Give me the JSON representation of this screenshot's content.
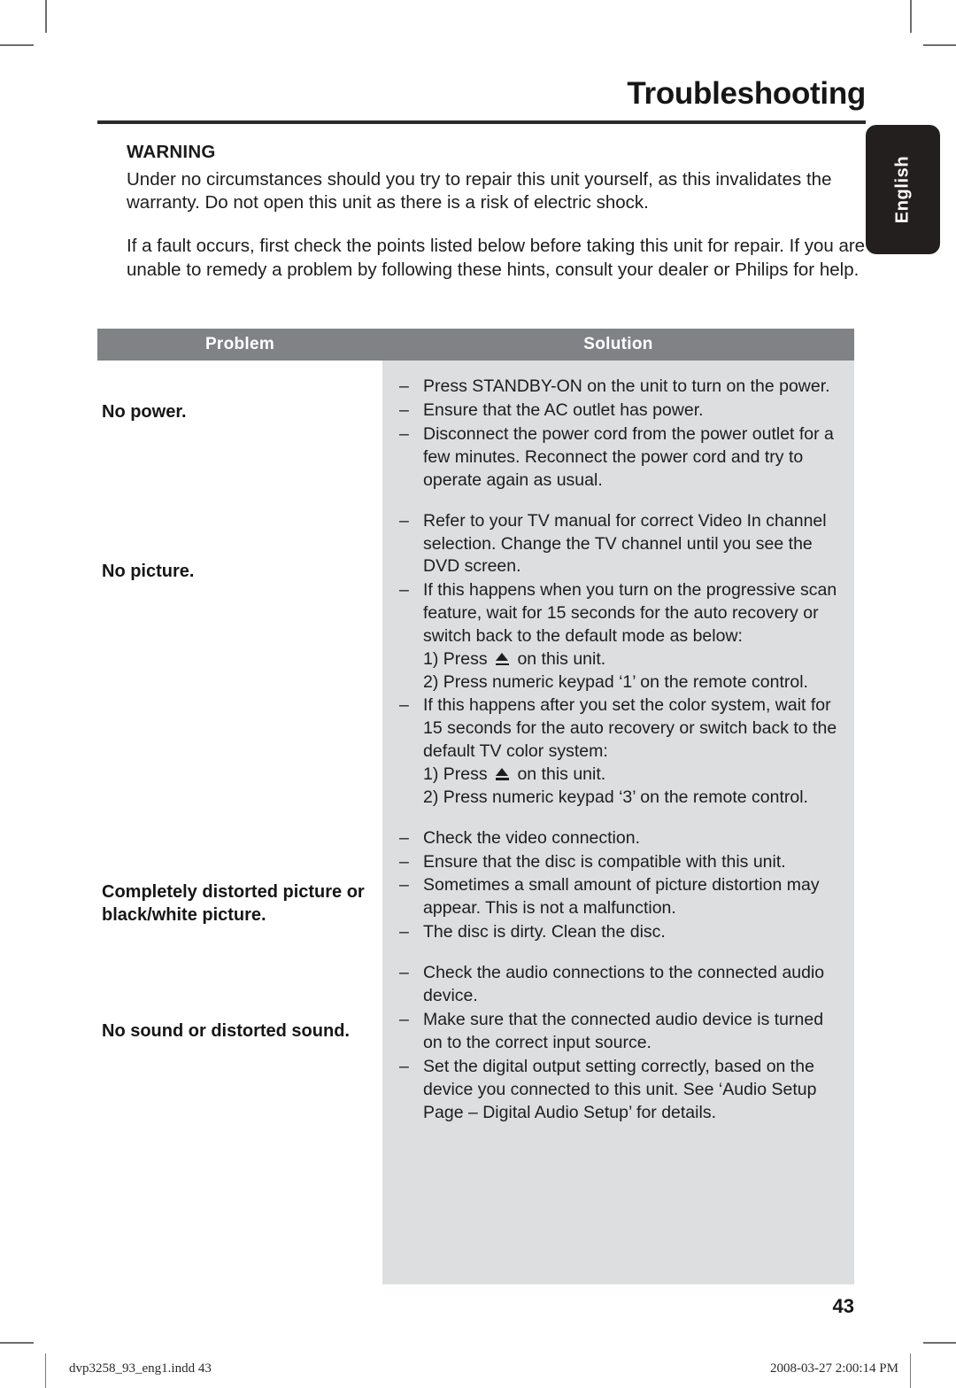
{
  "document": {
    "page_title": "Troubleshooting",
    "page_number": "43",
    "language_tab": "English"
  },
  "intro": {
    "warning_heading": "WARNING",
    "warning_text": "Under no circumstances should you try to repair this unit yourself, as this invalidates the warranty. Do not open this unit as there is a risk of electric shock.",
    "fault_text": "If a fault occurs, first check the points listed below before taking this unit for repair. If you are unable to remedy a problem by following these hints, consult your dealer or Philips for help."
  },
  "table": {
    "headers": {
      "problem": "Problem",
      "solution": "Solution"
    },
    "rows": [
      {
        "problem": "No power.",
        "solutions": [
          "Press STANDBY-ON on the unit to turn on the power.",
          "Ensure that the AC outlet has power.",
          "Disconnect the power cord from the power outlet for a few minutes. Reconnect the power cord and try to operate again as usual."
        ]
      },
      {
        "problem": "No picture.",
        "solutions": [
          "Refer to your TV manual for correct Video In channel selection. Change the TV channel until you see the DVD screen.",
          "If this happens when you turn on the progressive scan feature, wait for 15 seconds for the auto recovery or switch back to the default mode as below:"
        ],
        "substeps_1": [
          "1) Press ⏏ on this unit.",
          "2) Press numeric keypad ‘1’ on the remote control."
        ],
        "solutions_2": [
          "If this happens after you set the color system, wait for 15 seconds for the auto recovery or switch back to the default TV color system:"
        ],
        "substeps_2": [
          "1) Press ⏏ on this unit.",
          "2) Press numeric keypad ‘3’ on the remote control."
        ]
      },
      {
        "problem": "Completely distorted picture or black/white picture.",
        "solutions": [
          "Check the video connection.",
          "Ensure that the disc is compatible with this unit.",
          "Sometimes a small amount of picture distortion may appear. This is not a malfunction.",
          "The disc is dirty. Clean the disc."
        ]
      },
      {
        "problem": "No sound or distorted sound.",
        "solutions": [
          "Check the audio connections to the connected audio device.",
          "Make sure that the connected audio device is turned on to the correct input source.",
          "Set the digital output setting correctly, based on the device you connected to this unit. See ‘Audio Setup Page – Digital Audio Setup’ for details."
        ]
      }
    ],
    "dash": "–"
  },
  "footer": {
    "file_name": "dvp3258_93_eng1.indd   43",
    "timestamp": "2008-03-27   2:00:14 PM"
  },
  "colors": {
    "header_bar": "#808285",
    "solution_background": "#dddedf",
    "tab_background": "#231f1f",
    "text": "#1d1d1d"
  }
}
